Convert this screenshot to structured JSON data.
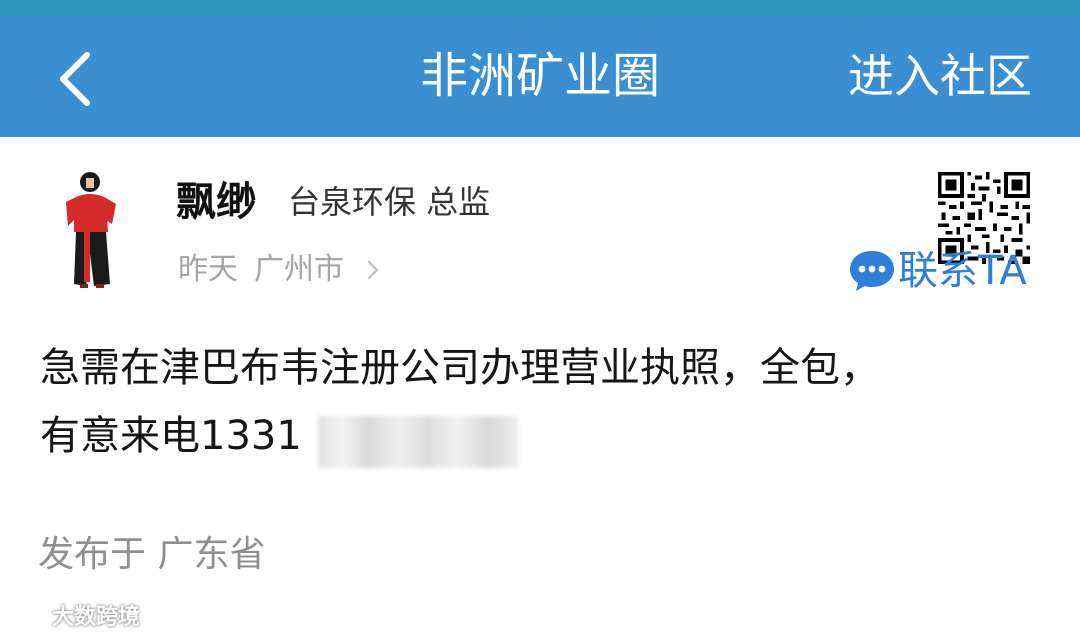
{
  "header": {
    "title": "非洲矿业圈",
    "join_label": "进入社区",
    "background_color": "#3a8fd3"
  },
  "post": {
    "author": {
      "name": "飘缈",
      "title": "台泉环保 总监"
    },
    "meta": {
      "time": "昨天",
      "city": "广州市"
    },
    "contact_label": "联系TA",
    "content_line1": "急需在津巴布韦注册公司办理营业执照，全包，",
    "content_line2_prefix": "有意来电1331",
    "location": "发布于 广东省"
  },
  "watermark": {
    "text": "大数跨境"
  },
  "icons": {
    "back": "chevron-left-icon",
    "meta_arrow": "chevron-right-icon",
    "contact": "chat-bubble-icon",
    "qr": "qr-code-icon"
  },
  "colors": {
    "accent": "#2f7ed8",
    "muted_text": "#a5a5a5"
  }
}
